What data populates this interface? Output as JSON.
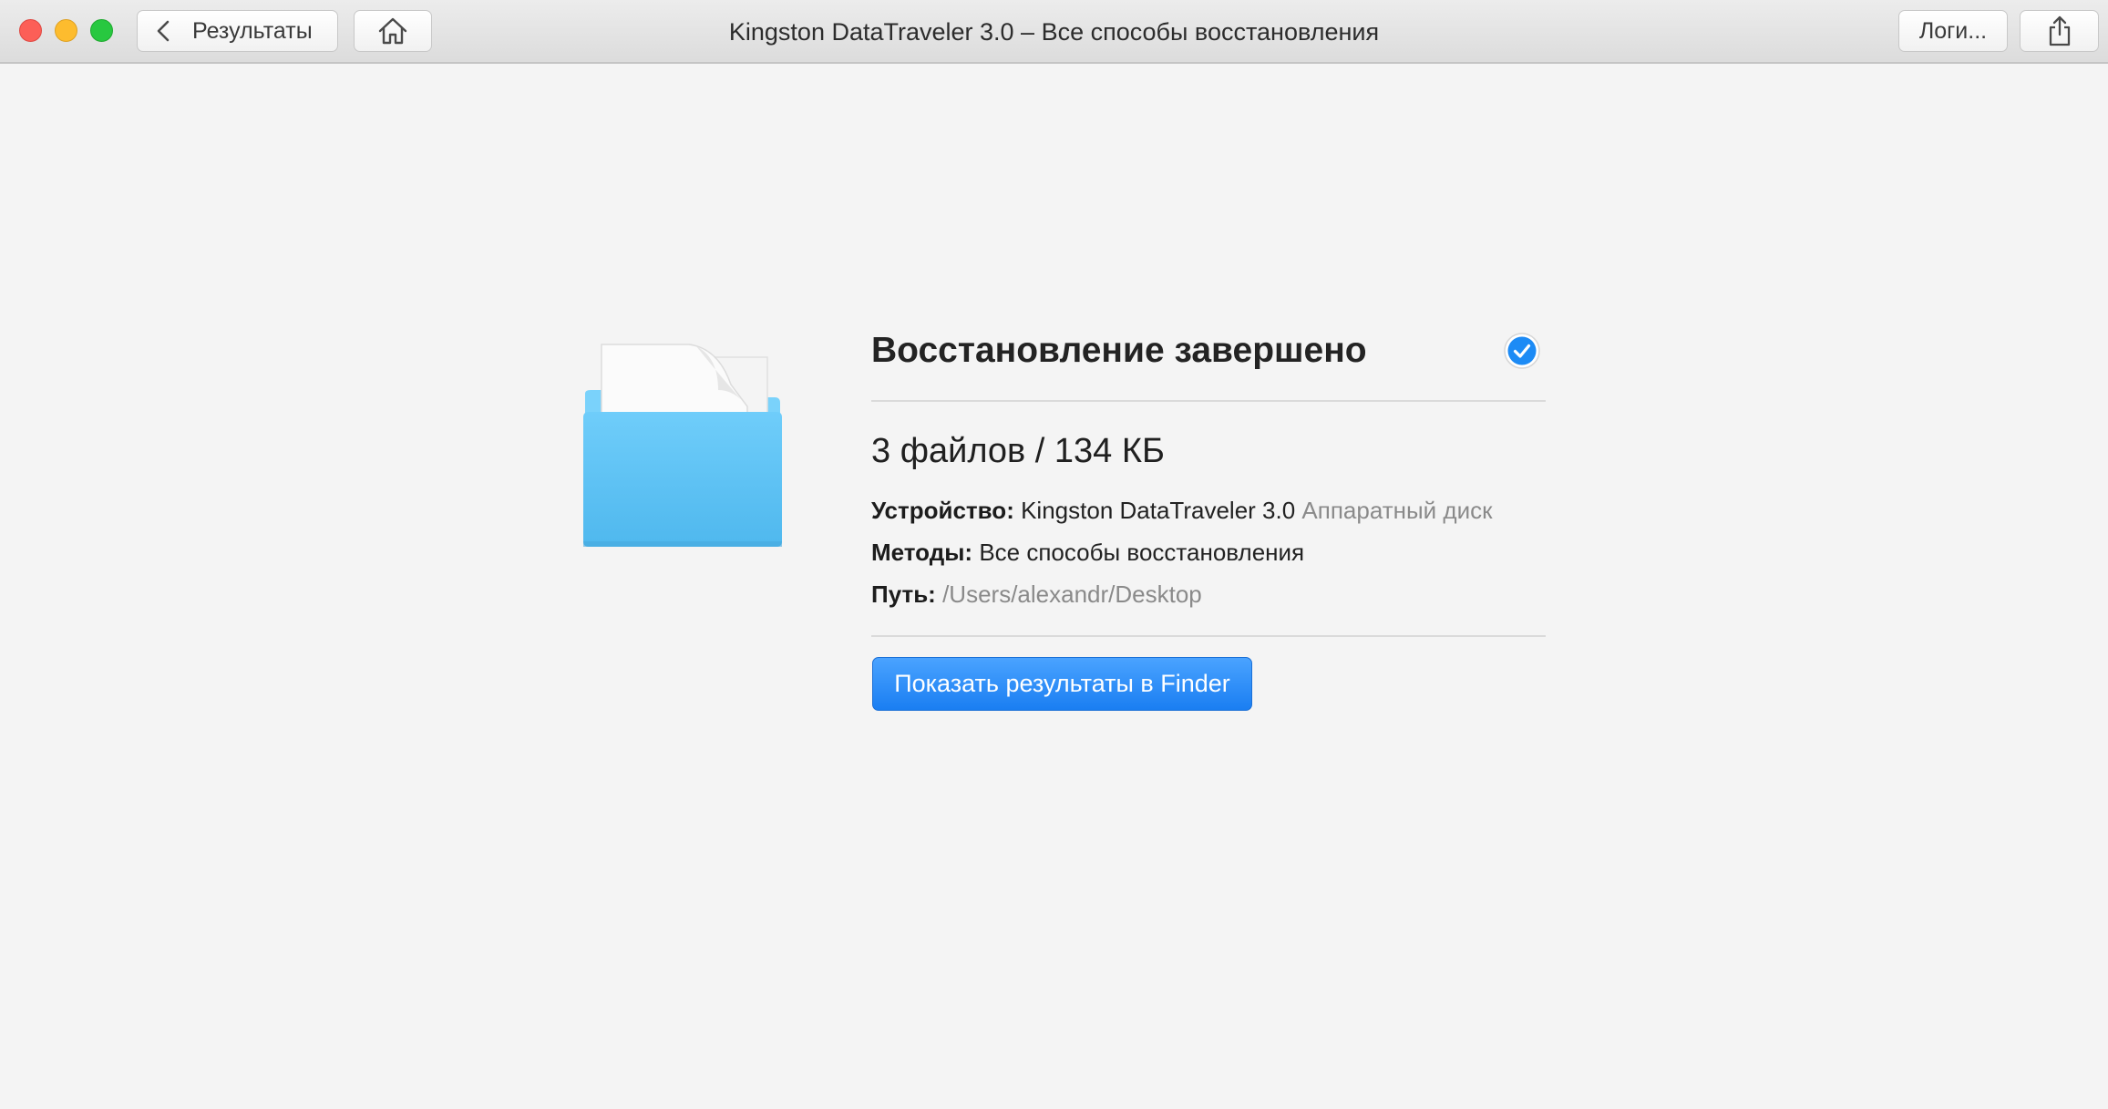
{
  "window": {
    "title": "Kingston DataTraveler 3.0 – Все способы восстановления"
  },
  "toolbar": {
    "back_label": "Результаты",
    "logs_label": "Логи..."
  },
  "icons": {
    "close": "close-window",
    "minimize": "minimize-window",
    "maximize": "zoom-window",
    "back": "chevron-left-icon",
    "home": "home-icon",
    "share": "share-icon",
    "folder": "folder-with-document-icon",
    "status": "checkmark-circle-icon"
  },
  "main": {
    "heading": "Восстановление завершено",
    "summary": "3 файлов / 134 КБ",
    "details": {
      "device_label": "Устройство:",
      "device_value": "Kingston DataTraveler 3.0",
      "device_type": "Аппаратный диск",
      "method_label": "Методы:",
      "method_value": "Все способы восстановления",
      "path_label": "Путь:",
      "path_value": "/Users/alexandr/Desktop"
    },
    "action_button": "Показать результаты в Finder"
  },
  "colors": {
    "accent_blue": "#1a7ef2",
    "folder_blue": "#5cc4f7",
    "background": "#f4f4f4",
    "muted_text": "#8a8a8a"
  }
}
